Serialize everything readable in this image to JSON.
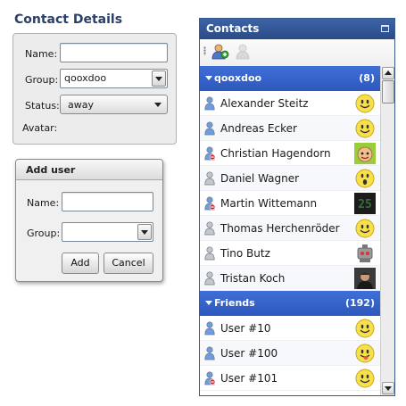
{
  "contact_details": {
    "title": "Contact Details",
    "name_label": "Name:",
    "name_value": "",
    "group_label": "Group:",
    "group_value": "qooxdoo",
    "status_label": "Status:",
    "status_value": "away",
    "avatar_label": "Avatar:"
  },
  "add_user": {
    "title": "Add user",
    "name_label": "Name:",
    "name_value": "",
    "group_label": "Group:",
    "group_value": "",
    "add_label": "Add",
    "cancel_label": "Cancel"
  },
  "contacts": {
    "title": "Contacts",
    "toolbar": [
      "add-contact-icon",
      "remove-contact-icon"
    ],
    "groups": [
      {
        "name": "qooxdoo",
        "count": "(8)",
        "members": [
          {
            "name": "Alexander Steitz",
            "status": "online",
            "avatar": "smiley"
          },
          {
            "name": "Andreas Ecker",
            "status": "online",
            "avatar": "smiley"
          },
          {
            "name": "Christian Hagendorn",
            "status": "busy",
            "avatar": "cartoon"
          },
          {
            "name": "Daniel Wagner",
            "status": "offline",
            "avatar": "surprised"
          },
          {
            "name": "Martin Wittemann",
            "status": "busy",
            "avatar": "digital-25"
          },
          {
            "name": "Thomas Herchenröder",
            "status": "offline",
            "avatar": "smiley"
          },
          {
            "name": "Tino Butz",
            "status": "offline",
            "avatar": "robot"
          },
          {
            "name": "Tristan Koch",
            "status": "offline",
            "avatar": "photo"
          }
        ]
      },
      {
        "name": "Friends",
        "count": "(192)",
        "members": [
          {
            "name": "User #10",
            "status": "online",
            "avatar": "smiley"
          },
          {
            "name": "User #100",
            "status": "online",
            "avatar": "tongue"
          },
          {
            "name": "User #101",
            "status": "busy",
            "avatar": "smiley"
          }
        ]
      }
    ]
  },
  "colors": {
    "title_text": "#2a3f6b",
    "caption_bg": "#2e4f8c",
    "group_bg": "#3562c9",
    "online": "#5b8ad6",
    "busy": "#d12a2a"
  }
}
